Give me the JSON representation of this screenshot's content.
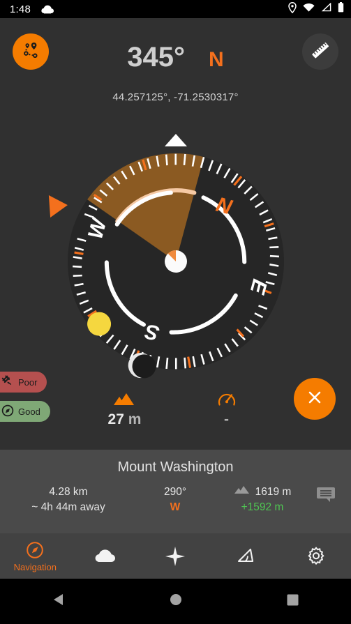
{
  "statusbar": {
    "time": "1:48",
    "icons": [
      "cloud-icon",
      "location-pin-icon",
      "wifi-icon",
      "cell-signal-icon",
      "battery-icon"
    ]
  },
  "header": {
    "route_button_icon": "route-waypoints-icon",
    "ruler_button_icon": "ruler-icon",
    "heading_degrees": "345°",
    "heading_direction": "N",
    "coordinates": "44.257125°,  -71.2530317°",
    "accent_color": "#f4701d"
  },
  "compass": {
    "heading": 345,
    "target_bearing": 290,
    "cardinals": [
      "N",
      "E",
      "S",
      "W"
    ],
    "north_label": "N",
    "east_label": "E",
    "south_label": "S",
    "west_label": "W",
    "north_color": "#f4701d",
    "wedge_color": "#8b5a22",
    "dial_color": "#262626",
    "tick_color": "#ffffff",
    "tick_accent_color": "#f4701d",
    "sun_color": "#f5d73f",
    "moon_color": "#1c1c1c",
    "marker_color": "#f4701d",
    "pointer_icon": "north-pointer-triangle",
    "sun_icon": "sun-marker-icon",
    "moon_icon": "moon-marker-icon",
    "target_marker_icon": "target-bearing-marker-icon"
  },
  "badges": [
    {
      "id": "gps",
      "label": "Poor",
      "icon": "satellite-icon",
      "color": "#b5504f"
    },
    {
      "id": "compass",
      "label": "Good",
      "icon": "compass-icon",
      "color": "#7fa876"
    }
  ],
  "metrics": [
    {
      "id": "altitude",
      "icon": "mountain-icon",
      "value": "27",
      "unit": "m"
    },
    {
      "id": "speed",
      "icon": "speedometer-icon",
      "value": "-",
      "unit": ""
    }
  ],
  "fab": {
    "icon": "close-x-icon",
    "color": "#f57c00"
  },
  "destination": {
    "title": "Mount Washington",
    "distance": "4.28 km",
    "eta": "~ 4h 44m away",
    "bearing": "290°",
    "bearing_direction": "W",
    "elevation_icon": "mountain-icon",
    "elevation": "1619 m",
    "elevation_delta": "+1592 m",
    "note_icon": "note-bubble-icon"
  },
  "bottomnav": {
    "items": [
      {
        "id": "navigation",
        "label": "Navigation",
        "icon": "compass-icon",
        "active": true
      },
      {
        "id": "weather",
        "label": "",
        "icon": "cloud-icon",
        "active": false
      },
      {
        "id": "stars",
        "label": "",
        "icon": "star-four-point-icon",
        "active": false
      },
      {
        "id": "inclinometer",
        "label": "",
        "icon": "angle-icon",
        "active": false
      },
      {
        "id": "settings",
        "label": "",
        "icon": "gear-icon",
        "active": false
      }
    ]
  },
  "androidnav": {
    "back_icon": "back-triangle-icon",
    "home_icon": "home-circle-icon",
    "recents_icon": "recents-square-icon"
  }
}
